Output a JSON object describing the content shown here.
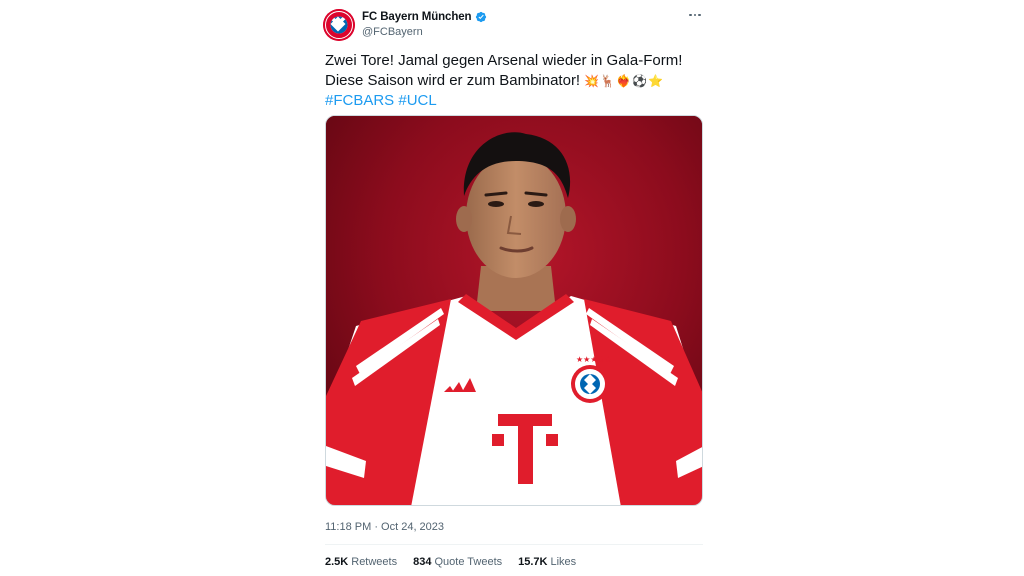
{
  "author": {
    "display_name": "FC Bayern München",
    "handle": "@FCBayern",
    "verified_icon": "verified-badge-icon",
    "brand_color": "#dc052d"
  },
  "tweet": {
    "line1": "Zwei Tore! Jamal gegen Arsenal wieder in Gala-Form!",
    "line2": "Diese Saison wird er zum Bambinator!",
    "emojis": "💥🦌❤️‍🔥⚽⭐",
    "hashtags": [
      "#FCBARS",
      "#UCL"
    ]
  },
  "media": {
    "jersey_sponsor": "T"
  },
  "timestamp": "11:18 PM · Oct 24, 2023",
  "stats": {
    "retweets_count": "2.5K",
    "retweets_label": "Retweets",
    "quotes_count": "834",
    "quotes_label": "Quote Tweets",
    "likes_count": "15.7K",
    "likes_label": "Likes"
  },
  "colors": {
    "link": "#1d9bf0",
    "secondary_text": "#536471",
    "primary_text": "#0f1419"
  }
}
